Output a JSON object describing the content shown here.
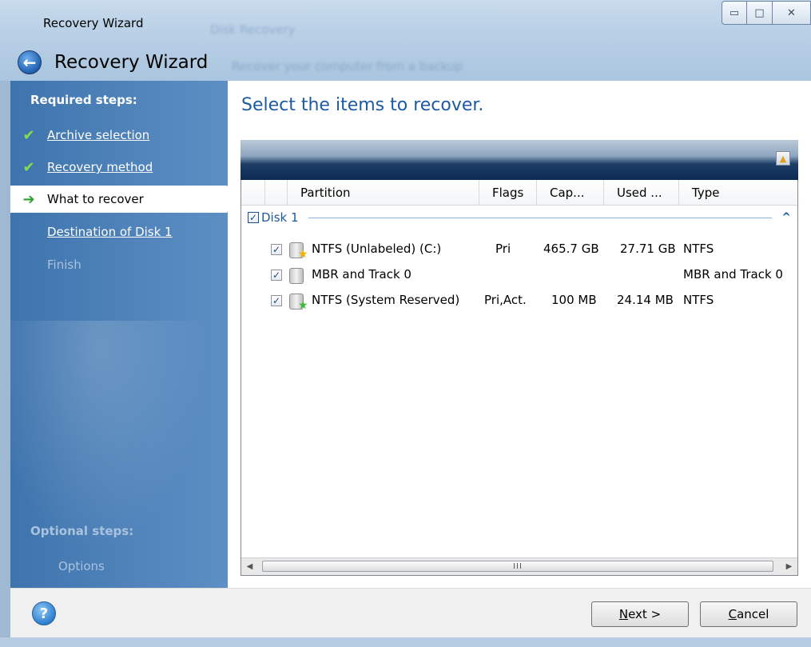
{
  "window": {
    "title": "Recovery Wizard"
  },
  "header": {
    "heading": "Recovery Wizard",
    "ghost_title": "Disk Recovery",
    "ghost_subtitle": "Recover your computer from a backup"
  },
  "window_controls": {
    "minimize": "▭",
    "maximize": "□",
    "close": "✕"
  },
  "sidebar": {
    "required_label": "Required steps:",
    "optional_label": "Optional steps:",
    "steps": [
      {
        "label": "Archive selection",
        "state": "done",
        "mark": "✔"
      },
      {
        "label": "Recovery method",
        "state": "done",
        "mark": "✔"
      },
      {
        "label": "What to recover",
        "state": "current",
        "mark": "➔"
      },
      {
        "label": "Destination of Disk 1",
        "state": "next",
        "mark": ""
      },
      {
        "label": "Finish",
        "state": "disabled",
        "mark": ""
      }
    ],
    "optional_steps": [
      {
        "label": "Options"
      }
    ]
  },
  "main": {
    "title": "Select the items to recover.",
    "columns": [
      "Partition",
      "Flags",
      "Cap...",
      "Used ...",
      "Type"
    ],
    "disk": {
      "label": "Disk 1",
      "checked": true,
      "collapse_glyph": "^"
    },
    "rows": [
      {
        "checked": true,
        "name": "NTFS (Unlabeled) (C:)",
        "flags": "Pri",
        "capacity": "465.7 GB",
        "used": "27.71 GB",
        "type": "NTFS",
        "badge": "★",
        "badge_color": "#f0b400"
      },
      {
        "checked": true,
        "name": "MBR and Track 0",
        "flags": "",
        "capacity": "",
        "used": "",
        "type": "MBR and Track 0",
        "badge": "",
        "badge_color": ""
      },
      {
        "checked": true,
        "name": "NTFS (System Reserved)",
        "flags": "Pri,Act.",
        "capacity": "100 MB",
        "used": "24.14 MB",
        "type": "NTFS",
        "badge": "★",
        "badge_color": "#3cb83c"
      }
    ],
    "scroll": {
      "left": "◀",
      "right": "▶",
      "grip": "III"
    }
  },
  "footer": {
    "help_glyph": "?",
    "next_label_ul": "N",
    "next_label_rest": "ext >",
    "cancel_label_ul": "C",
    "cancel_label_rest": "ancel"
  },
  "colors": {
    "accent_title": "#1d5aa0",
    "sidebar": "#4a7fb8",
    "done_check": "#7fe04a"
  }
}
